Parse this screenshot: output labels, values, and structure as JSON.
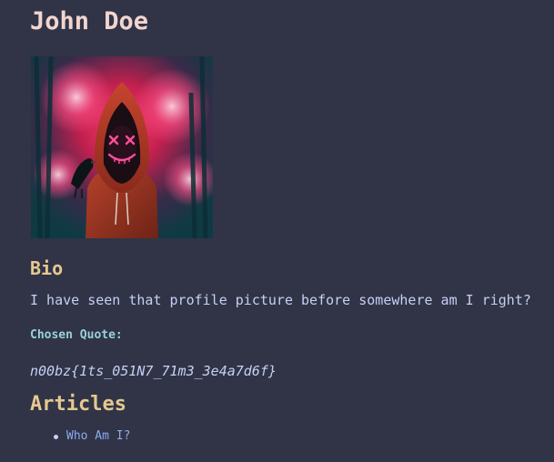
{
  "profile": {
    "name": "John Doe",
    "avatar_icon": "hooded-figure-neon-mask-avatar"
  },
  "bio": {
    "heading": "Bio",
    "text": "I have seen that profile picture before somewhere am I right?"
  },
  "quote": {
    "label": "Chosen Quote:",
    "text": "n00bz{1ts_051N7_71m3_3e4a7d6f}"
  },
  "articles": {
    "heading": "Articles",
    "items": [
      {
        "label": "Who Am I?"
      }
    ]
  },
  "colors": {
    "background": "#303446",
    "name": "#f2d5cf",
    "heading": "#e5c890",
    "text": "#c6d0f5",
    "quote_label": "#99d1db",
    "link": "#8caaee"
  }
}
